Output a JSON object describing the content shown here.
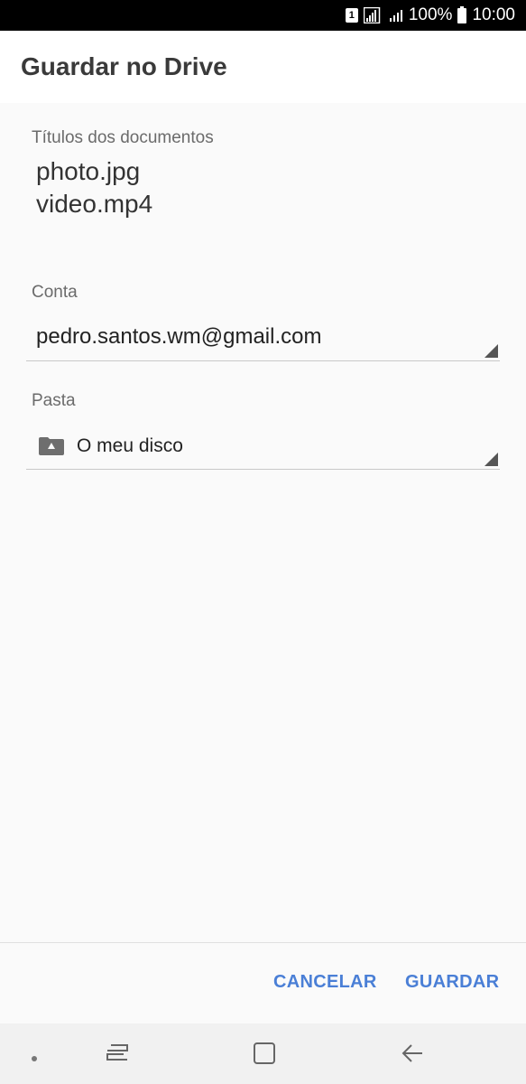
{
  "status_bar": {
    "sim_label": "1",
    "battery": "100%",
    "time": "10:00"
  },
  "header": {
    "title": "Guardar no Drive"
  },
  "documents": {
    "label": "Títulos dos documentos",
    "titles": [
      "photo.jpg",
      "video.mp4"
    ]
  },
  "account": {
    "label": "Conta",
    "value": "pedro.santos.wm@gmail.com"
  },
  "folder": {
    "label": "Pasta",
    "value": "O meu disco"
  },
  "actions": {
    "cancel_label": "CANCELAR",
    "save_label": "GUARDAR"
  },
  "colors": {
    "accent": "#4a7fd6",
    "status_bar": "#000000",
    "nav_bar": "#f1f1f1"
  },
  "nav_bar": {
    "icons": [
      "dot-icon",
      "recent-apps-icon",
      "home-icon",
      "back-icon"
    ]
  }
}
